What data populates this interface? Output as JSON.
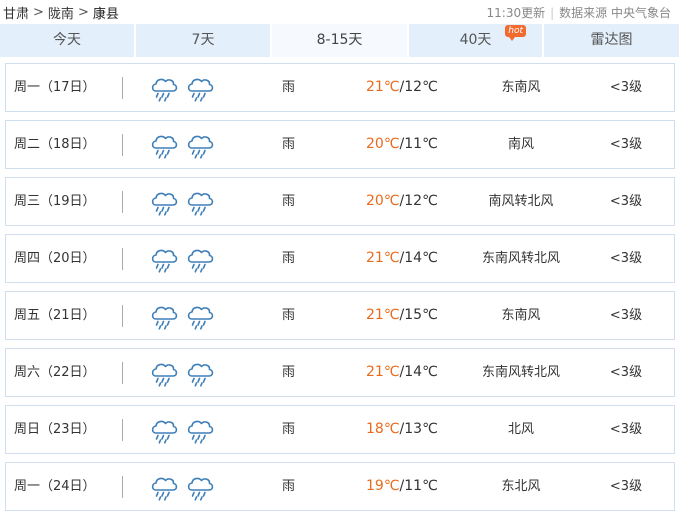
{
  "breadcrumb": {
    "province": "甘肃",
    "city": "陇南",
    "county": "康县",
    "separator": ">"
  },
  "meta": {
    "update_time": "11:30更新",
    "source_label": "数据来源 中央气象台"
  },
  "tabs": [
    {
      "label": "今天"
    },
    {
      "label": "7天"
    },
    {
      "label": "8-15天",
      "active": true
    },
    {
      "label": "40天",
      "badge": "hot"
    },
    {
      "label": "雷达图"
    }
  ],
  "colors": {
    "accent_temp": "#e86a1c",
    "tab_bg": "#e3effb",
    "row_border": "#cfdff0",
    "hot_badge": "#f26a2e"
  },
  "forecast": [
    {
      "day": "周一（17日）",
      "icon_day": "rain-icon",
      "icon_night": "rain-icon",
      "condition": "雨",
      "high": "21℃",
      "low": "/12℃",
      "wind": "东南风",
      "level": "<3级"
    },
    {
      "day": "周二（18日）",
      "icon_day": "rain-icon",
      "icon_night": "rain-icon",
      "condition": "雨",
      "high": "20℃",
      "low": "/11℃",
      "wind": "南风",
      "level": "<3级"
    },
    {
      "day": "周三（19日）",
      "icon_day": "rain-icon",
      "icon_night": "rain-icon",
      "condition": "雨",
      "high": "20℃",
      "low": "/12℃",
      "wind": "南风转北风",
      "level": "<3级"
    },
    {
      "day": "周四（20日）",
      "icon_day": "rain-icon",
      "icon_night": "rain-icon",
      "condition": "雨",
      "high": "21℃",
      "low": "/14℃",
      "wind": "东南风转北风",
      "level": "<3级"
    },
    {
      "day": "周五（21日）",
      "icon_day": "rain-icon",
      "icon_night": "rain-icon",
      "condition": "雨",
      "high": "21℃",
      "low": "/15℃",
      "wind": "东南风",
      "level": "<3级"
    },
    {
      "day": "周六（22日）",
      "icon_day": "rain-icon",
      "icon_night": "rain-icon",
      "condition": "雨",
      "high": "21℃",
      "low": "/14℃",
      "wind": "东南风转北风",
      "level": "<3级"
    },
    {
      "day": "周日（23日）",
      "icon_day": "rain-icon",
      "icon_night": "rain-icon",
      "condition": "雨",
      "high": "18℃",
      "low": "/13℃",
      "wind": "北风",
      "level": "<3级"
    },
    {
      "day": "周一（24日）",
      "icon_day": "rain-icon",
      "icon_night": "rain-icon",
      "condition": "雨",
      "high": "19℃",
      "low": "/11℃",
      "wind": "东北风",
      "level": "<3级"
    }
  ]
}
